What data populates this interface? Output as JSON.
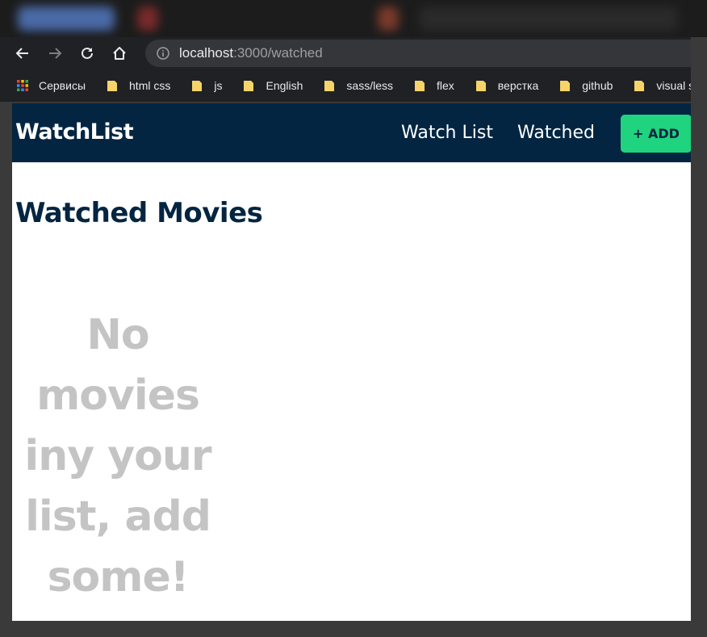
{
  "browser": {
    "url_host": "localhost",
    "url_rest": ":3000/watched",
    "bookmarks": [
      {
        "label": "Сервисы",
        "icon": "apps-icon"
      },
      {
        "label": "html css",
        "icon": "folder-icon"
      },
      {
        "label": "js",
        "icon": "folder-icon"
      },
      {
        "label": "English",
        "icon": "folder-icon"
      },
      {
        "label": "sass/less",
        "icon": "folder-icon"
      },
      {
        "label": "flex",
        "icon": "folder-icon"
      },
      {
        "label": "верстка",
        "icon": "folder-icon"
      },
      {
        "label": "github",
        "icon": "folder-icon"
      },
      {
        "label": "visual studio",
        "icon": "folder-icon"
      }
    ]
  },
  "app": {
    "brand": "WatchList",
    "nav": {
      "watch_list": "Watch List",
      "watched": "Watched",
      "add": "+ ADD"
    },
    "heading": "Watched Movies",
    "empty_message": "No movies iny your list, add some!"
  },
  "colors": {
    "header_bg": "#032541",
    "accent_green": "#1fd37f",
    "empty_text": "#c4c4c4"
  }
}
